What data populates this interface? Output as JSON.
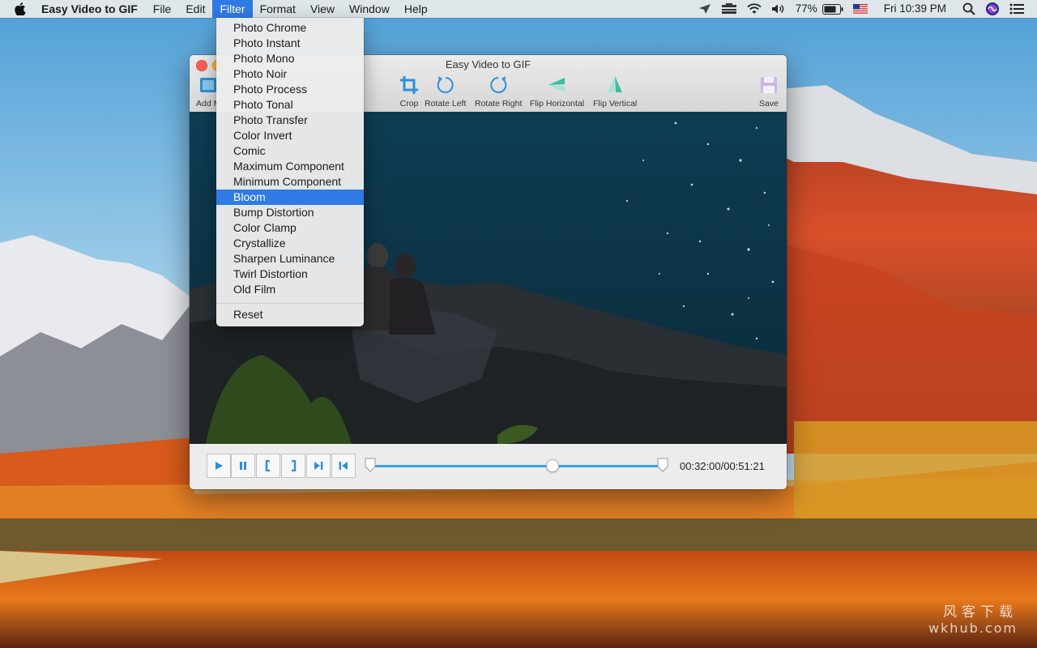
{
  "menubar": {
    "apple_icon": "apple-logo-icon",
    "app_name": "Easy Video to GIF",
    "menus": [
      "File",
      "Edit",
      "Filter",
      "Format",
      "View",
      "Window",
      "Help"
    ],
    "active_menu": "Filter",
    "status": {
      "battery_percent": "77%",
      "clock": "Fri 10:39 PM",
      "icons": [
        "location-arrow-icon",
        "tray-icon",
        "wifi-icon",
        "volume-icon",
        "battery-icon",
        "us-flag-icon",
        "search-icon",
        "siri-icon",
        "notification-list-icon"
      ]
    }
  },
  "filter_menu": {
    "items": [
      "Photo Chrome",
      "Photo Instant",
      "Photo Mono",
      "Photo Noir",
      "Photo Process",
      "Photo Tonal",
      "Photo Transfer",
      "Color Invert",
      "Comic",
      "Maximum Component",
      "Minimum Component",
      "Bloom",
      "Bump Distortion",
      "Color Clamp",
      "Crystallize",
      "Sharpen Luminance",
      "Twirl Distortion",
      "Old Film"
    ],
    "highlighted": "Bloom",
    "reset_label": "Reset"
  },
  "window": {
    "title": "Easy Video to GIF",
    "toolbar": {
      "add_label": "Add M",
      "crop_label": "Crop",
      "rotate_left_label": "Rotate Left",
      "rotate_right_label": "Rotate Right",
      "flip_horizontal_label": "Flip Horizontal",
      "flip_vertical_label": "Flip Vertical",
      "save_label": "Save"
    },
    "playback": {
      "timecode": "00:32:00/00:51:21",
      "progress_fraction": 0.623,
      "controls": [
        "play-icon",
        "pause-icon",
        "set-start-bracket-icon",
        "set-end-bracket-icon",
        "go-to-end-icon",
        "go-to-start-icon"
      ]
    }
  },
  "colors": {
    "accent": "#2f7ae5",
    "track": "#3aa0e6",
    "toolbar_icon": "#2e8fd8",
    "flip_icon": "#3dbea4"
  },
  "watermark": {
    "line1": "风客下载",
    "line2": "wkhub.com"
  }
}
